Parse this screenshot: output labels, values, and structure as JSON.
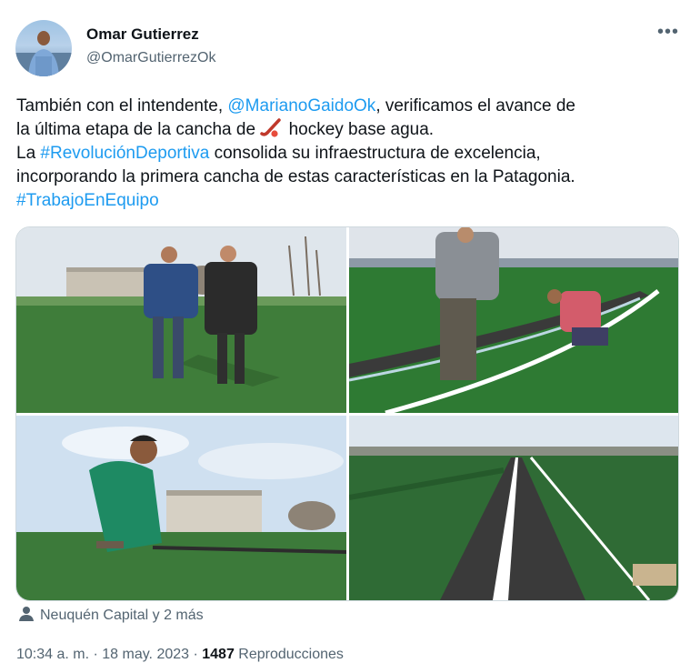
{
  "author": {
    "name": "Omar Gutierrez",
    "handle": "@OmarGutierrezOk"
  },
  "more_label": "•••",
  "tweet": {
    "line1_a": "También con el intendente, ",
    "mention": "@MarianoGaidoOk",
    "line1_b": ", verificamos el avance de",
    "line2_a": "la última etapa de la cancha de ",
    "line2_b": " hockey base agua.",
    "line3_a": "La ",
    "hashtag1": "#RevoluciónDeportiva",
    "line3_b": " consolida su infraestructura de excelencia,",
    "line4": "incorporando la primera cancha de estas características en la Patagonia.",
    "hashtag2": "#TrabajoEnEquipo",
    "emoji": "hockey-stick-icon"
  },
  "media": {
    "photos": [
      {
        "description_icon": "photo-men-walking-field"
      },
      {
        "description_icon": "photo-workers-installing-edge"
      },
      {
        "description_icon": "photo-worker-kneeling-turf"
      },
      {
        "description_icon": "photo-drainage-channel"
      }
    ]
  },
  "location": {
    "icon": "person-pin-icon",
    "label": "Neuquén Capital y 2 más"
  },
  "meta": {
    "time": "10:34 a. m. · 18 may. 2023 · ",
    "views_count": "1487",
    "views_label": " Reproducciones"
  },
  "colors": {
    "link": "#1d9bf0",
    "secondary_text": "#536471",
    "primary_text": "#0f1419",
    "turf": "#2f6b35"
  }
}
